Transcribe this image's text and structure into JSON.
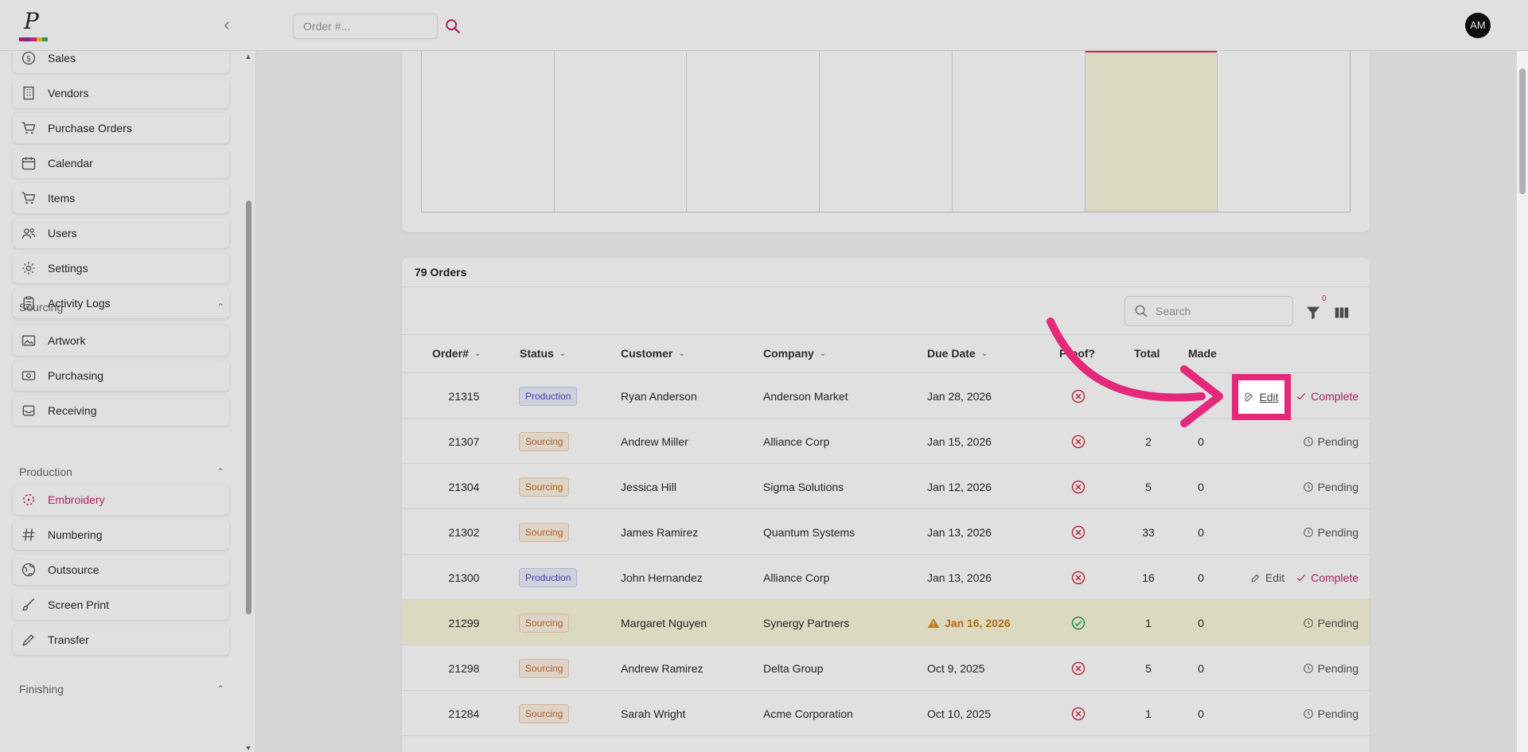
{
  "topbar": {
    "order_search_placeholder": "Order #...",
    "avatar_initials": "AM"
  },
  "colors": {
    "accent": "#c4286e",
    "highlight": "#e4287a",
    "today_column": "#fbf7dc",
    "warning_row": "#fbf7dc"
  },
  "sidebar": {
    "items_top": [
      {
        "label": "Sales",
        "icon": "dollar-circle-icon"
      },
      {
        "label": "Vendors",
        "icon": "building-icon"
      },
      {
        "label": "Purchase Orders",
        "icon": "cart-icon"
      },
      {
        "label": "Calendar",
        "icon": "calendar-icon"
      },
      {
        "label": "Items",
        "icon": "cart-icon"
      },
      {
        "label": "Users",
        "icon": "users-icon"
      },
      {
        "label": "Settings",
        "icon": "gear-icon"
      },
      {
        "label": "Activity Logs",
        "icon": "clipboard-icon"
      }
    ],
    "sections": [
      {
        "title": "Sourcing",
        "items": [
          {
            "label": "Artwork",
            "icon": "image-icon"
          },
          {
            "label": "Purchasing",
            "icon": "money-icon"
          },
          {
            "label": "Receiving",
            "icon": "inbox-icon"
          }
        ]
      },
      {
        "title": "Production",
        "items": [
          {
            "label": "Embroidery",
            "icon": "embroidery-icon",
            "active": true
          },
          {
            "label": "Numbering",
            "icon": "hash-icon"
          },
          {
            "label": "Outsource",
            "icon": "globe-icon"
          },
          {
            "label": "Screen Print",
            "icon": "brush-icon"
          },
          {
            "label": "Transfer",
            "icon": "pen-icon"
          }
        ]
      },
      {
        "title": "Finishing",
        "items": []
      }
    ]
  },
  "orders": {
    "title": "79 Orders",
    "search_placeholder": "Search",
    "filter_count": "0",
    "columns": [
      "Order#",
      "Status",
      "Customer",
      "Company",
      "Due Date",
      "Proof?",
      "Total",
      "Made"
    ],
    "visible_column_labels": {
      "proof_partial": "Proof?"
    },
    "rows": [
      {
        "order": "21315",
        "status": "Production",
        "customer": "Ryan Anderson",
        "company": "Anderson Market",
        "due": "Jan 28, 2026",
        "proof": "no",
        "total": "",
        "made": "",
        "edit": "Edit",
        "state": "Complete"
      },
      {
        "order": "21307",
        "status": "Sourcing",
        "customer": "Andrew Miller",
        "company": "Alliance Corp",
        "due": "Jan 15, 2026",
        "proof": "no",
        "total": "2",
        "made": "0",
        "edit": "",
        "state": "Pending"
      },
      {
        "order": "21304",
        "status": "Sourcing",
        "customer": "Jessica Hill",
        "company": "Sigma Solutions",
        "due": "Jan 12, 2026",
        "proof": "no",
        "total": "5",
        "made": "0",
        "edit": "",
        "state": "Pending"
      },
      {
        "order": "21302",
        "status": "Sourcing",
        "customer": "James Ramirez",
        "company": "Quantum Systems",
        "due": "Jan 13, 2026",
        "proof": "no",
        "total": "33",
        "made": "0",
        "edit": "",
        "state": "Pending"
      },
      {
        "order": "21300",
        "status": "Production",
        "customer": "John Hernandez",
        "company": "Alliance Corp",
        "due": "Jan 13, 2026",
        "proof": "no",
        "total": "16",
        "made": "0",
        "edit": "Edit",
        "state": "Complete"
      },
      {
        "order": "21299",
        "status": "Sourcing",
        "customer": "Margaret Nguyen",
        "company": "Synergy Partners",
        "due": "Jan 16, 2026",
        "proof": "yes",
        "total": "1",
        "made": "0",
        "edit": "",
        "state": "Pending",
        "warn": true
      },
      {
        "order": "21298",
        "status": "Sourcing",
        "customer": "Andrew Ramirez",
        "company": "Delta Group",
        "due": "Oct 9, 2025",
        "proof": "no",
        "total": "5",
        "made": "0",
        "edit": "",
        "state": "Pending"
      },
      {
        "order": "21284",
        "status": "Sourcing",
        "customer": "Sarah Wright",
        "company": "Acme Corporation",
        "due": "Oct 10, 2025",
        "proof": "no",
        "total": "1",
        "made": "0",
        "edit": "",
        "state": "Pending"
      }
    ]
  },
  "callout": {
    "edit_label": "Edit"
  }
}
